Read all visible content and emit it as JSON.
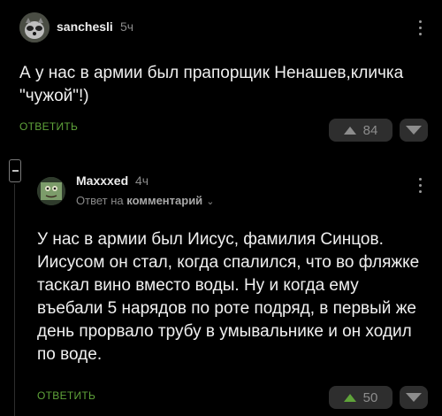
{
  "colors": {
    "background": "#000000",
    "accent_green": "#5fa33a",
    "muted": "#8a8a8a",
    "vote_bg": "#2e2e2e"
  },
  "comments": [
    {
      "username": "sanchesli",
      "time": "5ч",
      "text": "А у нас в армии был прапорщик Ненашев,кличка \"чужой\"!)",
      "reply_label": "ОТВЕТИТЬ",
      "rating": "84",
      "avatar_icon": "raccoon-avatar-icon"
    },
    {
      "username": "Maxxxed",
      "time": "4ч",
      "reply_to_prefix": "Ответ на",
      "reply_to_link": "комментарий",
      "text": "У нас в армии был Иисус, фамилия Синцов. Иисусом он стал, когда спалился, что во фляжке таскал вино вместо воды. Ну и когда ему въебали 5 нарядов по роте подряд, в первый же день прорвало трубу в умывальнике и он ходил по воде.",
      "reply_label": "ОТВЕТИТЬ",
      "rating": "50",
      "avatar_icon": "frog-avatar-icon"
    }
  ]
}
